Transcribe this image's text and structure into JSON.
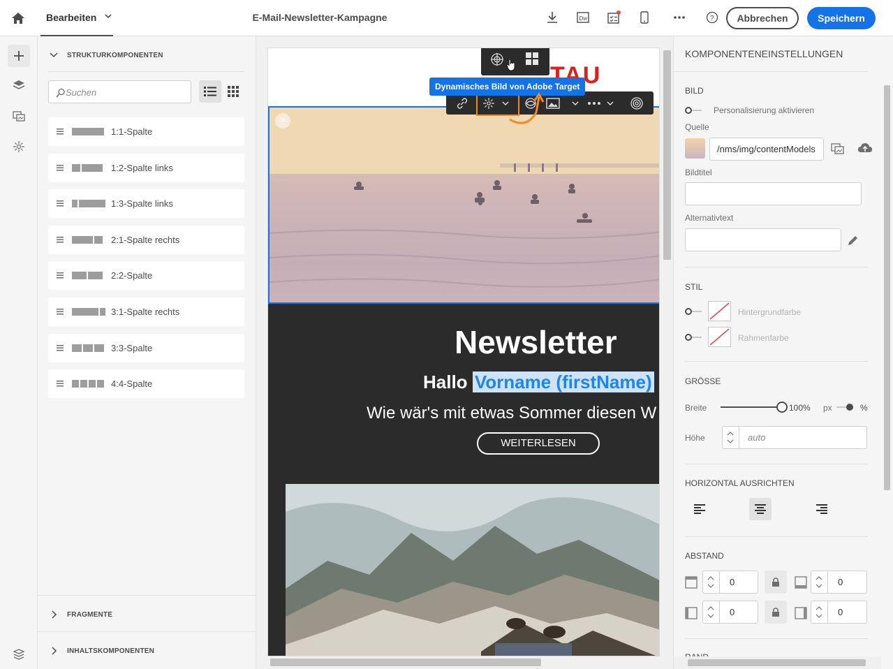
{
  "header": {
    "edit_menu": "Bearbeiten",
    "title": "E-Mail-Newsletter-Kampagne",
    "cancel": "Abbrechen",
    "save": "Speichern",
    "icons": [
      "home-icon",
      "download-icon",
      "dreamweaver-icon",
      "checklist-icon",
      "mobile-icon",
      "more-icon",
      "help-icon"
    ],
    "accent_color": "#1473e6"
  },
  "left_panel": {
    "structure_title": "STRUKTURKOMPONENTEN",
    "search_placeholder": "Suchen",
    "components": [
      {
        "label": "1:1-Spalte"
      },
      {
        "label": "1:2-Spalte links"
      },
      {
        "label": "1:3-Spalte links"
      },
      {
        "label": "2:1-Spalte rechts"
      },
      {
        "label": "2:2-Spalte"
      },
      {
        "label": "3:1-Spalte rechts"
      },
      {
        "label": "3:3-Spalte"
      },
      {
        "label": "4:4-Spalte"
      }
    ],
    "fragments_title": "FRAGMENTE",
    "content_title": "INHALTSKOMPONENTEN"
  },
  "canvas": {
    "logo_partial": "TAU",
    "tooltip": "Dynamisches Bild von Adobe Target",
    "newsletter_title": "Newsletter",
    "hello": "Hallo",
    "personalization_field": "Vorname (firstName)",
    "subtitle": "Wie wär's mit etwas Sommer diesen W",
    "read_more": "WEITERLESEN"
  },
  "right_panel": {
    "title": "KOMPONENTENEINSTELLUNGEN",
    "image_section": "BILD",
    "personalization_toggle": "Personalisierung aktivieren",
    "source_label": "Quelle",
    "source_value": "/nms/img/contentModels",
    "image_title_label": "Bildtitel",
    "alt_text_label": "Alternativtext",
    "style_section": "STIL",
    "background_color": "Hintergrundfarbe",
    "border_color": "Rahmenfarbe",
    "size_section": "GRÖSSE",
    "width_label": "Breite",
    "width_value": "100%",
    "width_slider_fraction": 1.0,
    "unit_px": "px",
    "unit_pct": "%",
    "height_label": "Höhe",
    "height_placeholder": "auto",
    "align_section": "HORIZONTAL AUSRICHTEN",
    "align_selected": "center",
    "spacing_section": "ABSTAND",
    "spacing": {
      "top": "0",
      "bottom": "0",
      "left": "0",
      "right": "0"
    },
    "next_section_partial": "RAND"
  }
}
